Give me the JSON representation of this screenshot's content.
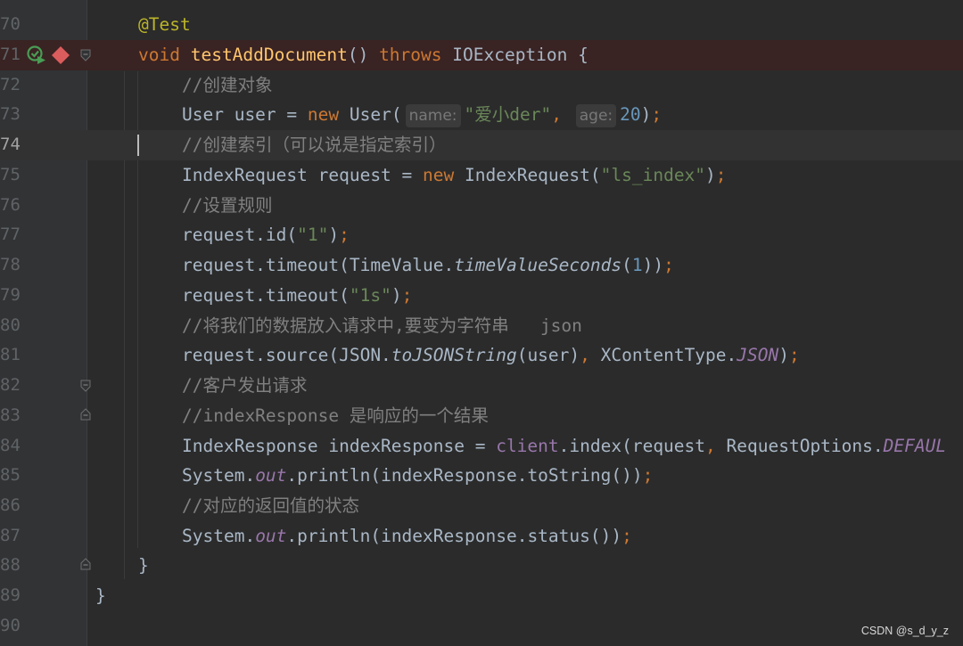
{
  "editor": {
    "line_numbers": [
      "70",
      "71",
      "72",
      "73",
      "74",
      "75",
      "76",
      "77",
      "78",
      "79",
      "80",
      "81",
      "82",
      "83",
      "84",
      "85",
      "86",
      "87",
      "88",
      "89",
      "90"
    ],
    "code": {
      "l70": {
        "annotation": "@Test"
      },
      "l71": {
        "void": "void",
        "method": "testAddDocument",
        "parens": "() ",
        "throws": "throws",
        "exception": " IOException {"
      },
      "l72": {
        "comment": "//创建对象"
      },
      "l73": {
        "a": "User user = ",
        "new": "new",
        "b": " User(",
        "hint_name": "name:",
        "str": "\"爱小der\"",
        "comma": ",",
        "hint_age": "age:",
        "num": "20",
        "close": ")",
        "semi": ";"
      },
      "l74": {
        "comment": "//创建索引（可以说是指定索引）"
      },
      "l75": {
        "a": "IndexRequest request = ",
        "new": "new",
        "b": " IndexRequest(",
        "str": "\"ls_index\"",
        "close": ")",
        "semi": ";"
      },
      "l76": {
        "comment": "//设置规则"
      },
      "l77": {
        "a": "request.id(",
        "str": "\"1\"",
        "close": ")",
        "semi": ";"
      },
      "l78": {
        "a": "request.timeout(TimeValue.",
        "italic": "timeValueSeconds",
        "b": "(",
        "num": "1",
        "close": "))",
        "semi": ";"
      },
      "l79": {
        "a": "request.timeout(",
        "str": "\"1s\"",
        "close": ")",
        "semi": ";"
      },
      "l80": {
        "comment": "//将我们的数据放入请求中,要变为字符串   json"
      },
      "l81": {
        "a": "request.source(JSON.",
        "italic": "toJSONString",
        "b": "(user)",
        "comma": ",",
        "c": " XContentType.",
        "const": "JSON",
        "close": ")",
        "semi": ";"
      },
      "l82": {
        "comment": "//客户发出请求"
      },
      "l83": {
        "comment": "//indexResponse 是响应的一个结果"
      },
      "l84": {
        "a": "IndexResponse indexResponse = ",
        "client": "client",
        "b": ".index(request",
        "comma": ",",
        "c": " RequestOptions.",
        "const": "DEFAUL"
      },
      "l85": {
        "a": "System.",
        "out": "out",
        "b": ".println(indexResponse.toString())",
        "semi": ";"
      },
      "l86": {
        "comment": "//对应的返回值的状态"
      },
      "l87": {
        "a": "System.",
        "out": "out",
        "b": ".println(indexResponse.status())",
        "semi": ";"
      },
      "l88": {
        "brace": "}"
      },
      "l89": {
        "brace": "}"
      }
    }
  },
  "watermark": "CSDN @s_d_y_z",
  "colors": {
    "background": "#2b2b2b",
    "gutter": "#313335",
    "keyword": "#cc7832",
    "string": "#6a8759",
    "number": "#6897bb",
    "comment": "#808080",
    "method": "#ffc66d",
    "annotation": "#bbb529",
    "static_field": "#9876aa",
    "breakpoint": "#db5c5c",
    "run_icon": "#499c54"
  },
  "icons": {
    "run": "run-test-icon",
    "breakpoint": "breakpoint-icon",
    "fold": "fold-marker-icon"
  }
}
